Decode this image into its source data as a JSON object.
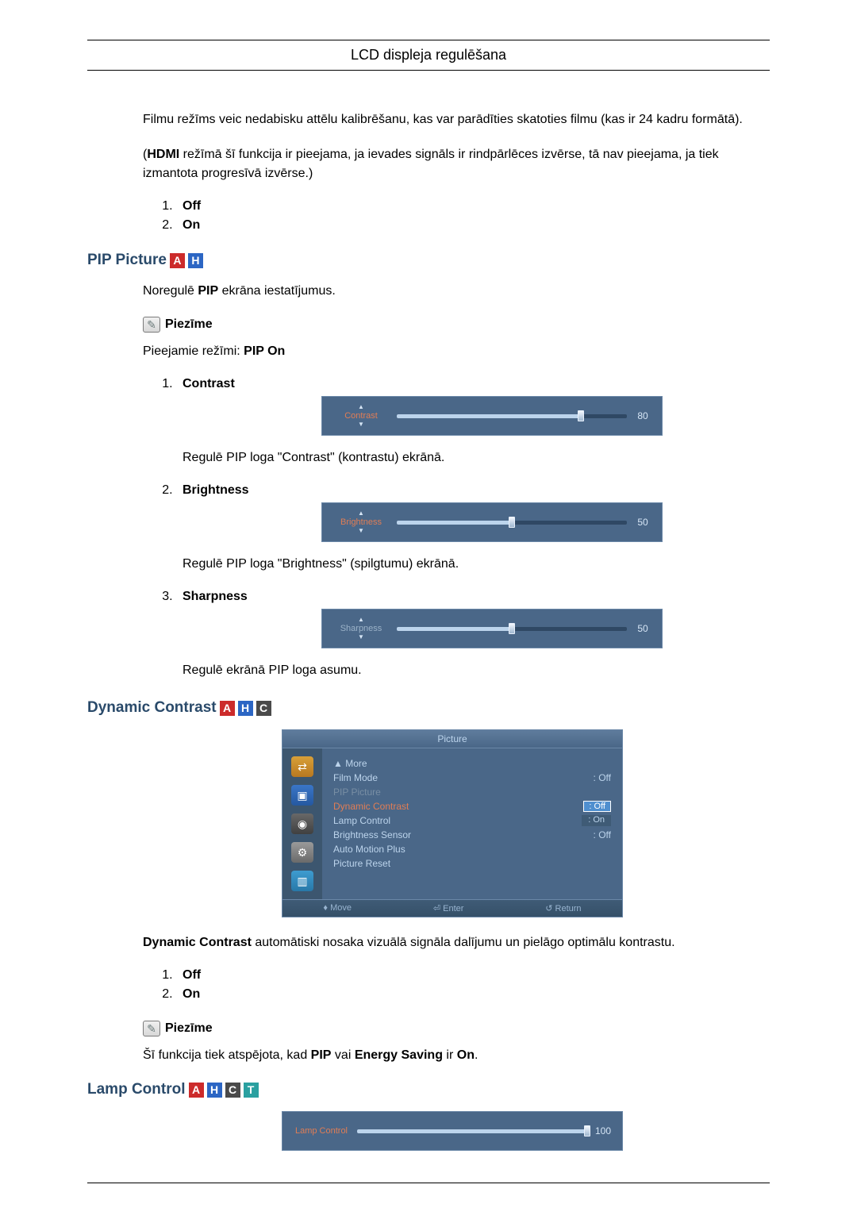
{
  "header": {
    "title": "LCD displeja regulēšana"
  },
  "intro": {
    "film_desc": "Filmu režīms veic nedabisku attēlu kalibrēšanu, kas var parādīties skatoties filmu (kas ir 24 kadru formātā).",
    "hdmi_prefix": "(",
    "hdmi_bold": "HDMI",
    "hdmi_suffix": " režīmā šī funkcija ir pieejama, ja ievades signāls ir rindpārlēces izvērse, tā nav pieejama, ja tiek izmantota progresīvā izvērse.)",
    "list": {
      "off": "Off",
      "on": "On"
    }
  },
  "pip": {
    "heading": "PIP Picture",
    "badges": [
      "A",
      "H"
    ],
    "desc_prefix": "Noregulē ",
    "desc_bold": "PIP",
    "desc_suffix": " ekrāna iestatījumus.",
    "note_label": "Piezīme",
    "modes_prefix": "Pieejamie režīmi: ",
    "modes_bold": "PIP On",
    "items": [
      {
        "name": "Contrast",
        "slider": {
          "label": "Contrast",
          "value": 80,
          "color": "red"
        },
        "desc": "Regulē PIP loga \"Contrast\" (kontrastu) ekrānā."
      },
      {
        "name": "Brightness",
        "slider": {
          "label": "Brightness",
          "value": 50,
          "color": "red"
        },
        "desc": "Regulē PIP loga \"Brightness\" (spilgtumu) ekrānā."
      },
      {
        "name": "Sharpness",
        "slider": {
          "label": "Sharpness",
          "value": 50,
          "color": "grey"
        },
        "desc": "Regulē ekrānā PIP loga asumu."
      }
    ]
  },
  "dyncon": {
    "heading": "Dynamic Contrast",
    "badges": [
      "A",
      "H",
      "C"
    ],
    "osd": {
      "title": "Picture",
      "more": "▲ More",
      "rows": [
        {
          "name": "Film Mode",
          "val": "Off",
          "dim": false
        },
        {
          "name": "PIP Picture",
          "val": "",
          "dim": true
        },
        {
          "name": "Dynamic Contrast",
          "val": "Off",
          "dim": false,
          "highlight": true,
          "name_red": true
        },
        {
          "name": "Lamp Control",
          "val": "On",
          "dim": false,
          "box": true
        },
        {
          "name": "Brightness Sensor",
          "val": "Off",
          "dim": false
        },
        {
          "name": "Auto Motion Plus",
          "val": "",
          "dim": false
        },
        {
          "name": "Picture Reset",
          "val": "",
          "dim": false
        }
      ],
      "footer": [
        "♦ Move",
        "⏎ Enter",
        "↺ Return"
      ]
    },
    "desc_bold": "Dynamic Contrast",
    "desc_suffix": " automātiski nosaka vizuālā signāla dalījumu un pielāgo optimālu kontrastu.",
    "list": {
      "off": "Off",
      "on": "On"
    },
    "note_label": "Piezīme",
    "disabled_prefix": "Šī funkcija tiek atspējota, kad ",
    "pip_bold": "PIP",
    "or_text": " vai ",
    "energy_bold": "Energy Saving",
    "is_text": " ir ",
    "on_bold": "On",
    "period": "."
  },
  "lamp": {
    "heading": "Lamp Control",
    "badges": [
      "A",
      "H",
      "C",
      "T"
    ],
    "slider": {
      "label": "Lamp Control",
      "value": 100,
      "color": "red"
    }
  }
}
